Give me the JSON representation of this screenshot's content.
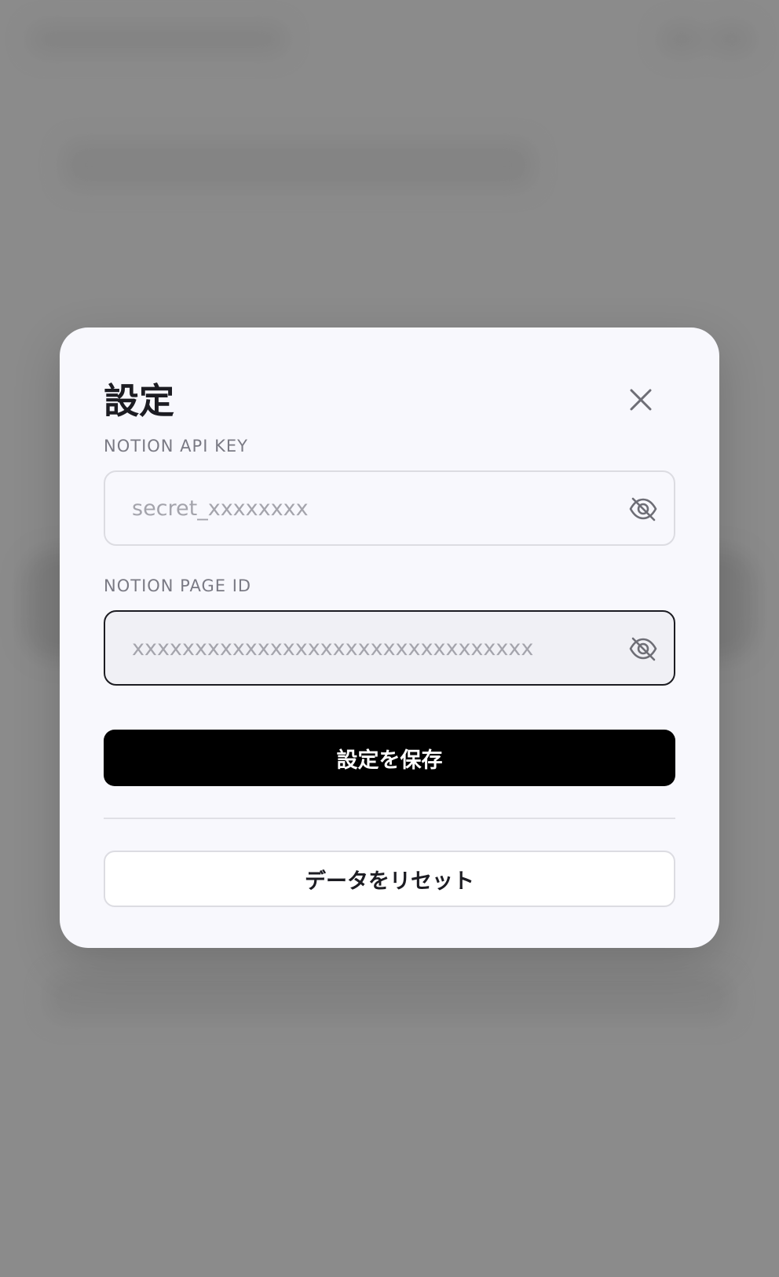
{
  "modal": {
    "title": "設定",
    "close_icon": "close-icon",
    "api_key": {
      "label": "NOTION API KEY",
      "value": "",
      "placeholder": "secret_xxxxxxxx",
      "toggle_icon": "eye-off-icon"
    },
    "page_id": {
      "label": "NOTION PAGE ID",
      "value": "",
      "placeholder": "xxxxxxxxxxxxxxxxxxxxxxxxxxxxxxxx",
      "toggle_icon": "eye-off-icon"
    },
    "save_label": "設定を保存",
    "reset_label": "データをリセット"
  },
  "colors": {
    "backdrop": "#929292",
    "modal_bg": "#f8f8fd",
    "primary": "#000000",
    "focus_border": "#1c1c22",
    "label": "#7a7a84",
    "placeholder": "#a4a4ac"
  }
}
